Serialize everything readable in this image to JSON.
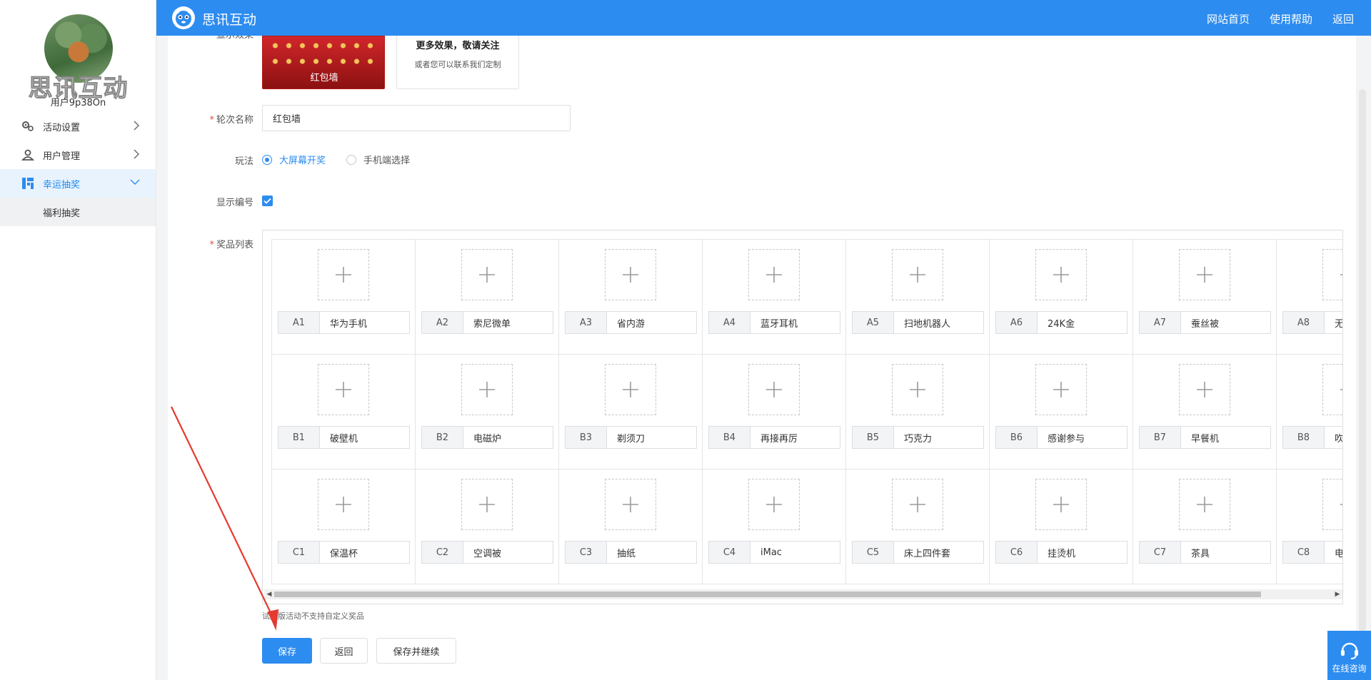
{
  "sidebar": {
    "brand_overlay": "思讯互动",
    "username": "用户9p38On",
    "items": [
      {
        "label": "活动设置",
        "icon": "gears-icon"
      },
      {
        "label": "用户管理",
        "icon": "user-icon"
      },
      {
        "label": "幸运抽奖",
        "icon": "grid-icon",
        "active": true
      }
    ],
    "subitems": [
      {
        "label": "福利抽奖"
      }
    ]
  },
  "header": {
    "title": "思讯互动",
    "links": [
      "网站首页",
      "使用帮助",
      "返回"
    ]
  },
  "preview": {
    "card1_label": "红包墙",
    "card2_title": "更多效果，敬请关注",
    "card2_sub": "或者您可以联系我们定制"
  },
  "form": {
    "round_name_label": "轮次名称",
    "round_name_value": "红包墙",
    "play_label": "玩法",
    "play_options": [
      "大屏幕开奖",
      "手机端选择"
    ],
    "play_selected": "大屏幕开奖",
    "show_number_label": "显示编号",
    "show_number_checked": true,
    "prize_list_label": "奖品列表",
    "hint": "试用版活动不支持自定义奖品"
  },
  "prizes": [
    [
      {
        "code": "A1",
        "name": "华为手机"
      },
      {
        "code": "A2",
        "name": "索尼微单"
      },
      {
        "code": "A3",
        "name": "省内游"
      },
      {
        "code": "A4",
        "name": "蓝牙耳机"
      },
      {
        "code": "A5",
        "name": "扫地机器人"
      },
      {
        "code": "A6",
        "name": "24K金"
      },
      {
        "code": "A7",
        "name": "蚕丝被"
      },
      {
        "code": "A8",
        "name": "无"
      }
    ],
    [
      {
        "code": "B1",
        "name": "破壁机"
      },
      {
        "code": "B2",
        "name": "电磁炉"
      },
      {
        "code": "B3",
        "name": "剃须刀"
      },
      {
        "code": "B4",
        "name": "再接再厉"
      },
      {
        "code": "B5",
        "name": "巧克力"
      },
      {
        "code": "B6",
        "name": "感谢参与"
      },
      {
        "code": "B7",
        "name": "早餐机"
      },
      {
        "code": "B8",
        "name": "吹"
      }
    ],
    [
      {
        "code": "C1",
        "name": "保温杯"
      },
      {
        "code": "C2",
        "name": "空调被"
      },
      {
        "code": "C3",
        "name": "抽纸"
      },
      {
        "code": "C4",
        "name": "iMac"
      },
      {
        "code": "C5",
        "name": "床上四件套"
      },
      {
        "code": "C6",
        "name": "挂烫机"
      },
      {
        "code": "C7",
        "name": "茶具"
      },
      {
        "code": "C8",
        "name": "电"
      }
    ]
  ],
  "buttons": {
    "save": "保存",
    "back": "返回",
    "save_continue": "保存并继续"
  },
  "consult": {
    "label": "在线咨询"
  },
  "colors": {
    "primary": "#2d8cf0",
    "required": "#e74c3c",
    "annotation_arrow": "#e53a2f"
  }
}
